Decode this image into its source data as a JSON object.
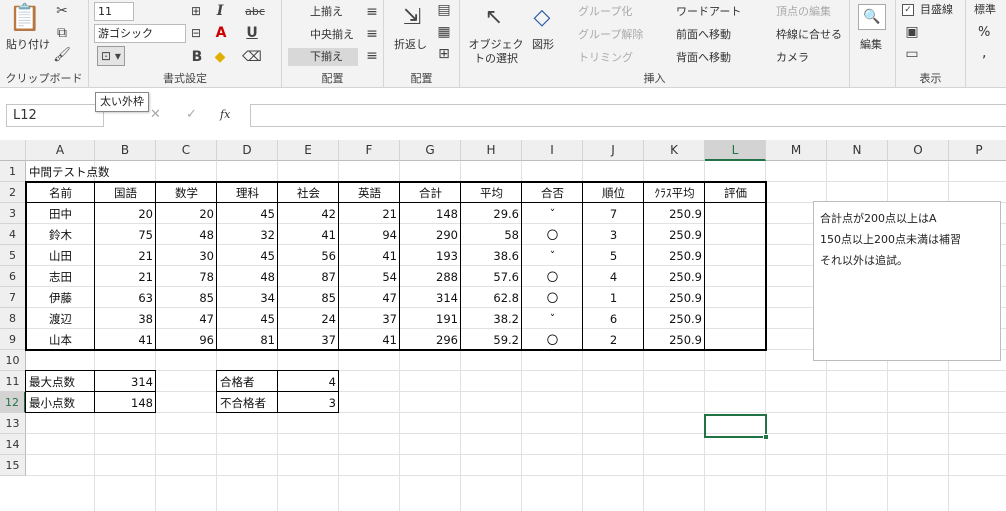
{
  "ribbon": {
    "paste": "貼り付け",
    "clipboard_group": "クリップボード",
    "font_size": "11",
    "font_name": "游ゴシック",
    "font_group": "書式設定",
    "align_top": "上揃え",
    "align_middle": "中央揃え",
    "align_bottom": "下揃え",
    "align_group": "配置",
    "wrap": "折返し",
    "arrange_group": "配置",
    "select_objects": "オブジェクトの選択",
    "shapes": "図形",
    "group": "グループ化",
    "ungroup": "グループ解除",
    "trim": "トリミング",
    "wordart": "ワードアート",
    "bring_forward": "前面へ移動",
    "send_backward": "背面へ移動",
    "edit_points": "頂点の編集",
    "snap_border": "枠線に合せる",
    "camera": "カメラ",
    "insert_group": "挿入",
    "edit": "編集",
    "gridlines": "目盛線",
    "view_group": "表示",
    "standard": "標準",
    "percent": "%",
    "comma": ","
  },
  "tooltip": "太い外枠",
  "formula_bar": {
    "name_box": "L12",
    "fx": "fx",
    "cancel": "✕",
    "enter": "✓"
  },
  "columns": [
    "A",
    "B",
    "C",
    "D",
    "E",
    "F",
    "G",
    "H",
    "I",
    "J",
    "K",
    "L",
    "M",
    "N",
    "O",
    "P"
  ],
  "rows": [
    "1",
    "2",
    "3",
    "4",
    "5",
    "6",
    "7",
    "8",
    "9",
    "10",
    "11",
    "12",
    "13",
    "14",
    "15"
  ],
  "title": "中間テスト点数",
  "headers": [
    "名前",
    "国語",
    "数学",
    "理科",
    "社会",
    "英語",
    "合計",
    "平均",
    "合否",
    "順位",
    "ｸﾗｽ平均",
    "評価"
  ],
  "students": [
    {
      "name": "田中",
      "kokugo": "20",
      "sugaku": "20",
      "rika": "45",
      "shakai": "42",
      "eigo": "21",
      "total": "148",
      "avg": "29.6",
      "pass": "ˇ",
      "rank": "7",
      "class_avg": "250.9"
    },
    {
      "name": "鈴木",
      "kokugo": "75",
      "sugaku": "48",
      "rika": "32",
      "shakai": "41",
      "eigo": "94",
      "total": "290",
      "avg": "58",
      "pass": "〇",
      "rank": "3",
      "class_avg": "250.9"
    },
    {
      "name": "山田",
      "kokugo": "21",
      "sugaku": "30",
      "rika": "45",
      "shakai": "56",
      "eigo": "41",
      "total": "193",
      "avg": "38.6",
      "pass": "ˇ",
      "rank": "5",
      "class_avg": "250.9"
    },
    {
      "name": "志田",
      "kokugo": "21",
      "sugaku": "78",
      "rika": "48",
      "shakai": "87",
      "eigo": "54",
      "total": "288",
      "avg": "57.6",
      "pass": "〇",
      "rank": "4",
      "class_avg": "250.9"
    },
    {
      "name": "伊藤",
      "kokugo": "63",
      "sugaku": "85",
      "rika": "34",
      "shakai": "85",
      "eigo": "47",
      "total": "314",
      "avg": "62.8",
      "pass": "〇",
      "rank": "1",
      "class_avg": "250.9"
    },
    {
      "name": "渡辺",
      "kokugo": "38",
      "sugaku": "47",
      "rika": "45",
      "shakai": "24",
      "eigo": "37",
      "total": "191",
      "avg": "38.2",
      "pass": "ˇ",
      "rank": "6",
      "class_avg": "250.9"
    },
    {
      "name": "山本",
      "kokugo": "41",
      "sugaku": "96",
      "rika": "81",
      "shakai": "37",
      "eigo": "41",
      "total": "296",
      "avg": "59.2",
      "pass": "〇",
      "rank": "2",
      "class_avg": "250.9"
    }
  ],
  "summary": {
    "max_label": "最大点数",
    "max_value": "314",
    "min_label": "最小点数",
    "min_value": "148",
    "pass_label": "合格者",
    "pass_value": "4",
    "fail_label": "不合格者",
    "fail_value": "3"
  },
  "note": [
    "合計点が200点以上はA",
    "150点以上200点未満は補習",
    "それ以外は追試。"
  ],
  "accent_color": "#217346"
}
